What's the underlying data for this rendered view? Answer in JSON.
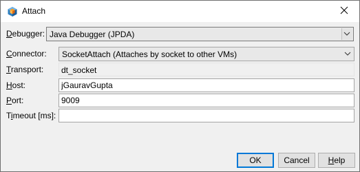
{
  "window": {
    "title": "Attach"
  },
  "icons": {
    "app": "netbeans-cube-icon",
    "close": "close-icon",
    "dropdown": "chevron-down-icon"
  },
  "colors": {
    "accent": "#0078d7",
    "field_border": "#a5a5a5",
    "window_bg": "#f0f0f0"
  },
  "form": {
    "debugger": {
      "label": "Debugger:",
      "mnemonic": "D",
      "label_rest": "ebugger:",
      "value": "Java Debugger (JPDA)"
    },
    "connector": {
      "label": "Connector:",
      "mnemonic": "C",
      "label_rest": "onnector:",
      "value": "SocketAttach (Attaches by socket to other VMs)"
    },
    "transport": {
      "label": "Transport:",
      "mnemonic": "T",
      "label_rest": "ransport:",
      "value": "dt_socket"
    },
    "host": {
      "label": "Host:",
      "mnemonic": "H",
      "label_rest": "ost:",
      "value": "jGauravGupta"
    },
    "port": {
      "label": "Port:",
      "mnemonic": "P",
      "label_rest": "ort:",
      "value": "9009"
    },
    "timeout": {
      "label": "Timeout [ms]:",
      "label_pre": "T",
      "mnemonic": "i",
      "label_rest": "meout [ms]:",
      "value": ""
    }
  },
  "buttons": {
    "ok": {
      "label": "OK"
    },
    "cancel": {
      "label": "Cancel"
    },
    "help": {
      "label": "Help",
      "mnemonic": "H",
      "label_rest": "elp"
    }
  }
}
